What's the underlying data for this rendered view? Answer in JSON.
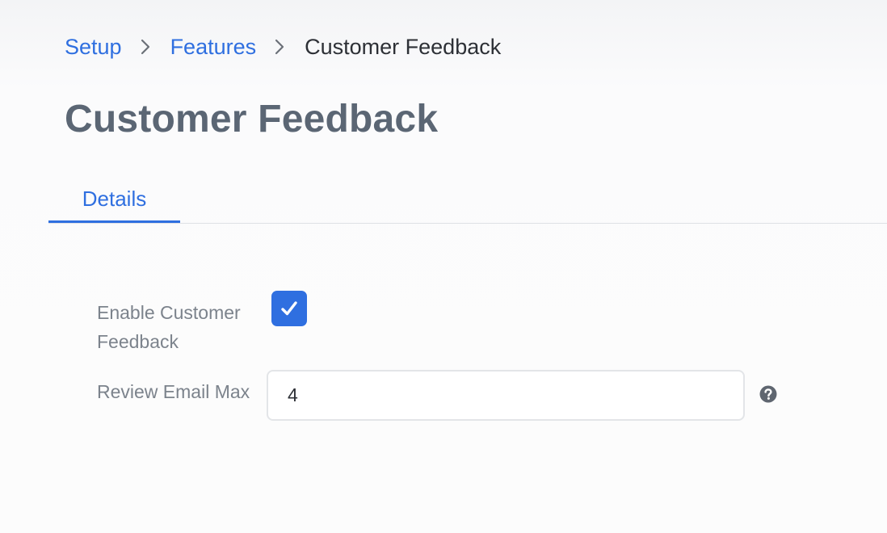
{
  "breadcrumb": {
    "items": [
      {
        "label": "Setup",
        "link": true
      },
      {
        "label": "Features",
        "link": true
      },
      {
        "label": "Customer Feedback",
        "link": false
      }
    ]
  },
  "page_title": "Customer Feedback",
  "tabs": [
    {
      "label": "Details",
      "active": true
    }
  ],
  "form": {
    "enable_feedback": {
      "label": "Enable Customer Feedback",
      "checked": true
    },
    "review_email_max": {
      "label": "Review Email Max",
      "value": "4",
      "help_icon": "question-circle-icon"
    }
  },
  "colors": {
    "accent": "#2f6fe0",
    "title": "#5b6674",
    "label": "#7c838c"
  }
}
